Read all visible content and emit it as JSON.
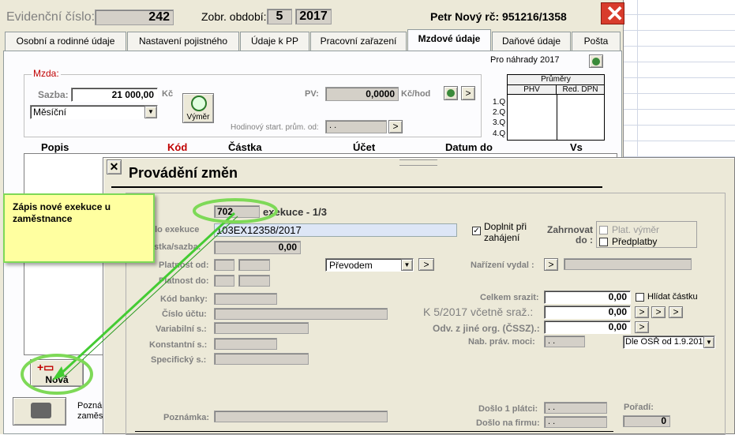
{
  "header": {
    "evid_label": "Evidenční číslo:",
    "evid_value": "242",
    "period_label": "Zobr. období:",
    "period_month": "5",
    "period_year": "2017",
    "person": "Petr Nový rč: 951216/1358"
  },
  "tabs": [
    "Osobní a rodinné údaje",
    "Nastavení pojistného",
    "Údaje k PP",
    "Pracovní zařazení",
    "Mzdové údaje",
    "Daňové údaje",
    "Pošta"
  ],
  "wage": {
    "group_label": "Mzda:",
    "sazba_label": "Sazba:",
    "sazba_value": "21 000,00",
    "currency": "Kč",
    "type_value": "Měsíční",
    "vymer_button": "Výměr",
    "pv_label": "PV:",
    "pv_value": "0,0000",
    "pv_unit": "Kč/hod",
    "hourly_label": "Hodinový start. prům. od:",
    "hourly_value": ". .",
    "replacement_label": "Pro náhrady 2017",
    "averages_title": "Průměry",
    "averages_cols": [
      "PHV",
      "Red. DPN"
    ],
    "quarters": [
      "1.Q",
      "2.Q",
      "3.Q",
      "4.Q"
    ]
  },
  "list_columns": [
    "Popis",
    "Kód",
    "Částka",
    "Účet",
    "Datum do",
    "Vs"
  ],
  "bottom": {
    "new_button": "Nová",
    "note_label": "Pozná",
    "note_label2": "zaměs"
  },
  "callout": {
    "text": "Zápis nové exekuce u zaměstnance"
  },
  "dialog": {
    "title": "Provádění změn",
    "code_value": "702",
    "exec_title": "exekuce - 1/3",
    "cislo_label": "Číslo exekuce",
    "cislo_value": "103EX12358/2017",
    "castka_label": "Částka/sazba:",
    "castka_value": "0,00",
    "platnost_od_label": "Platnost od:",
    "platnost_do_label": "Platnost do:",
    "kod_banky_label": "Kód banky:",
    "cislo_uctu_label": "Číslo účtu:",
    "variabilni_label": "Variabilní s.:",
    "konstantni_label": "Konstantní s.:",
    "specificky_label": "Specifický s.:",
    "poznamka_label": "Poznámka:",
    "payment_value": "Převodem",
    "doplnit_label": "Doplnit při zahájení",
    "doplnit_checked": true,
    "zahrnovat_label": "Zahrnovat do :",
    "plat_vymer_label": "Plat. výměr",
    "predplatby_label": "Předplatby",
    "narizeni_label": "Nařízení vydal :",
    "celkem_label": "Celkem srazit:",
    "celkem_value": "0,00",
    "hlidat_label": "Hlídat částku",
    "k5_label": "K 5/2017 včetně sraž.:",
    "k5_value": "0,00",
    "odv_label": "Odv. z jiné org. (ČSSZ).:",
    "odv_value": "0,00",
    "nab_label": "Nab. práv. moci:",
    "nab_value": ". .",
    "osr_value": "Dle OSŘ od 1.9.201",
    "doslo_platci_label": "Došlo 1 plátci:",
    "doslo_platci_value": ". .",
    "doslo_firmu_label": "Došlo na firmu:",
    "doslo_firmu_value": ". .",
    "poradi_label": "Pořadí:",
    "poradi_value": "0",
    "button_gt": ">"
  },
  "colors": {
    "window_bg": "#ece9d8",
    "close_red": "#d83c2c",
    "callout_bg": "#ffffa0",
    "callout_border": "#3cb043",
    "green_line": "#44cc33",
    "blue_field": "#dde6f6",
    "mzda_red": "#c00000"
  }
}
